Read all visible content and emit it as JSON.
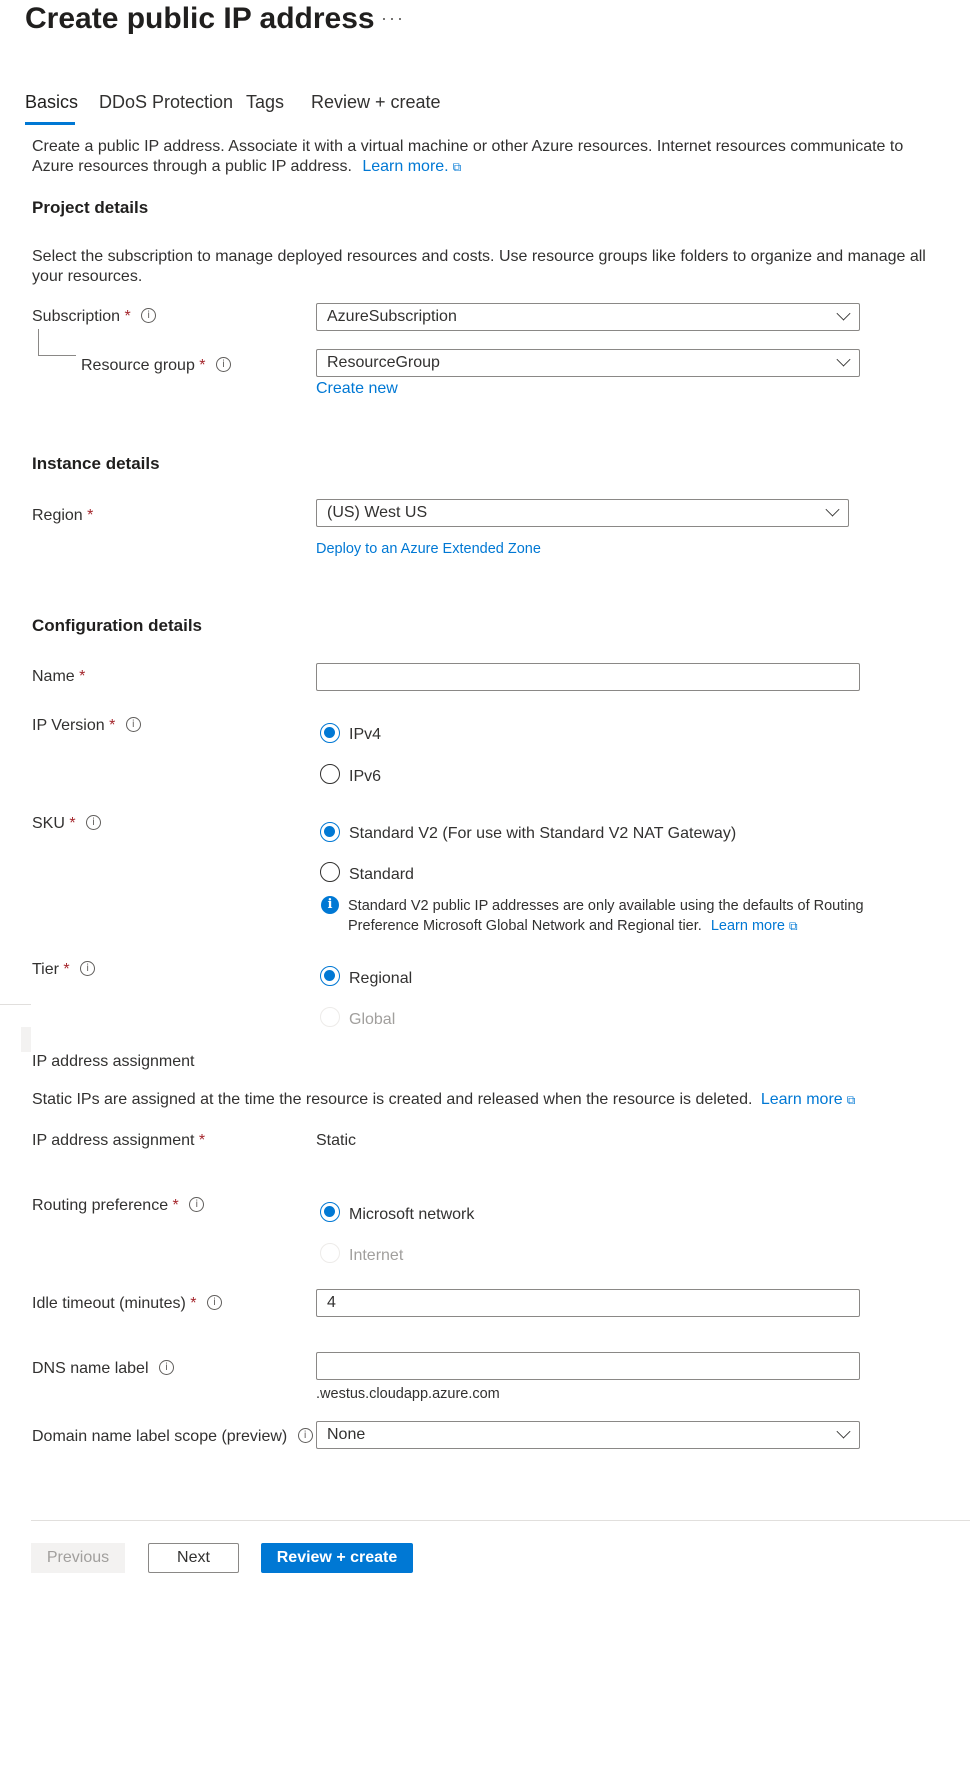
{
  "header": {
    "title": "Create public IP address",
    "more": "···"
  },
  "tabs": [
    {
      "label": "Basics"
    },
    {
      "label": "DDoS Protection"
    },
    {
      "label": "Tags"
    },
    {
      "label": "Review + create"
    }
  ],
  "intro": {
    "line1": "Create a public IP address. Associate it with a virtual machine or other Azure resources. Internet resources communicate to",
    "line2": "Azure resources through a public IP address.",
    "learn_more": "Learn more."
  },
  "project": {
    "title": "Project details",
    "desc1": "Select the subscription to manage deployed resources and costs. Use resource groups like folders to organize and manage all",
    "desc2": "your resources.",
    "subscription_label": "Subscription",
    "subscription_value": "AzureSubscription",
    "rg_label": "Resource group",
    "rg_value": "ResourceGroup",
    "create_new": "Create new"
  },
  "instance": {
    "title": "Instance details",
    "region_label": "Region",
    "region_value": "(US) West US",
    "extended_zone": "Deploy to an Azure Extended Zone"
  },
  "config": {
    "title": "Configuration details",
    "name_label": "Name",
    "name_value": "",
    "ipver_label": "IP Version",
    "ipv4": "IPv4",
    "ipv6": "IPv6",
    "sku_label": "SKU",
    "sku_v2": "Standard V2 (For use with Standard V2 NAT Gateway)",
    "sku_std": "Standard",
    "sku_info1": "Standard V2 public IP addresses are only available using the defaults of Routing",
    "sku_info2": "Preference Microsoft Global Network and Regional tier.",
    "sku_learn": "Learn more",
    "tier_label": "Tier",
    "tier_regional": "Regional",
    "tier_global": "Global"
  },
  "assignment": {
    "title": "IP address assignment",
    "desc": "Static IPs are assigned at the time the resource is created and released when the resource is deleted.",
    "learn": "Learn more",
    "label": "IP address assignment",
    "value": "Static",
    "routing_label": "Routing preference",
    "routing_ms": "Microsoft network",
    "routing_internet": "Internet",
    "idle_label": "Idle timeout (minutes)",
    "idle_value": "4",
    "dns_label": "DNS name label",
    "dns_value": "",
    "dns_suffix": ".westus.cloudapp.azure.com",
    "scope_label": "Domain name label scope (preview)",
    "scope_value": "None"
  },
  "footer": {
    "previous": "Previous",
    "next": "Next",
    "review": "Review + create"
  },
  "common": {
    "required": "*",
    "info": "i",
    "external": "⧉"
  }
}
